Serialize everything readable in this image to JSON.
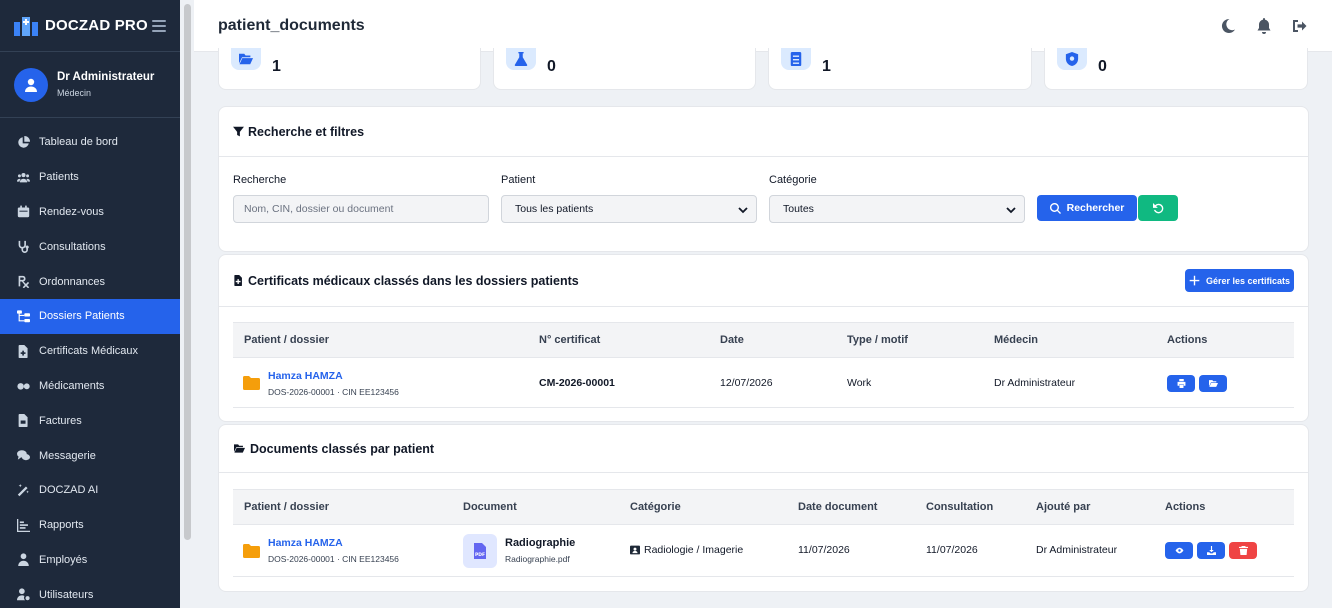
{
  "app": {
    "brand": "DOCZAD PRO",
    "page_title": "patient_documents"
  },
  "user": {
    "name": "Dr Administrateur",
    "role": "Médecin"
  },
  "nav": [
    {
      "label": "Tableau de bord",
      "icon": "chart-pie-icon",
      "active": false
    },
    {
      "label": "Patients",
      "icon": "users-icon",
      "active": false
    },
    {
      "label": "Rendez-vous",
      "icon": "calendar-icon",
      "active": false
    },
    {
      "label": "Consultations",
      "icon": "stethoscope-icon",
      "active": false
    },
    {
      "label": "Ordonnances",
      "icon": "prescription-icon",
      "active": false
    },
    {
      "label": "Dossiers Patients",
      "icon": "folder-tree-icon",
      "active": true
    },
    {
      "label": "Certificats Médicaux",
      "icon": "file-medical-icon",
      "active": false
    },
    {
      "label": "Médicaments",
      "icon": "pills-icon",
      "active": false
    },
    {
      "label": "Factures",
      "icon": "file-invoice-icon",
      "active": false
    },
    {
      "label": "Messagerie",
      "icon": "comments-icon",
      "active": false
    },
    {
      "label": "DOCZAD AI",
      "icon": "magic-wand-icon",
      "active": false
    },
    {
      "label": "Rapports",
      "icon": "chart-bar-icon",
      "active": false
    },
    {
      "label": "Employés",
      "icon": "user-tie-icon",
      "active": false
    },
    {
      "label": "Utilisateurs",
      "icon": "user-gear-icon",
      "active": false
    }
  ],
  "stats": [
    {
      "value": "1",
      "icon": "folder-open-icon"
    },
    {
      "value": "0",
      "icon": "flask-icon"
    },
    {
      "value": "1",
      "icon": "file-medical-icon"
    },
    {
      "value": "0",
      "icon": "shield-icon"
    }
  ],
  "filters": {
    "title": "Recherche et filtres",
    "search_label": "Recherche",
    "search_placeholder": "Nom, CIN, dossier ou document",
    "patient_label": "Patient",
    "patient_value": "Tous les patients",
    "category_label": "Catégorie",
    "category_value": "Toutes",
    "search_button": "Rechercher"
  },
  "certificates": {
    "title": "Certificats médicaux classés dans les dossiers patients",
    "manage_button": "Gérer les certificats",
    "columns": [
      "Patient / dossier",
      "N° certificat",
      "Date",
      "Type / motif",
      "Médecin",
      "Actions"
    ],
    "rows": [
      {
        "patient": "Hamza HAMZA",
        "folder": "DOS-2026-00001 · CIN EE123456",
        "number": "CM-2026-00001",
        "date": "12/07/2026",
        "type": "Work",
        "doctor": "Dr Administrateur"
      }
    ]
  },
  "documents": {
    "title": "Documents classés par patient",
    "columns": [
      "Patient / dossier",
      "Document",
      "Catégorie",
      "Date document",
      "Consultation",
      "Ajouté par",
      "Actions"
    ],
    "rows": [
      {
        "patient": "Hamza HAMZA",
        "folder": "DOS-2026-00001 · CIN EE123456",
        "doc_name": "Radiographie",
        "doc_file": "Radiographie.pdf",
        "category": "Radiologie / Imagerie",
        "doc_date": "11/07/2026",
        "consultation": "11/07/2026",
        "added_by": "Dr Administrateur"
      }
    ]
  },
  "colors": {
    "primary": "#2563eb",
    "success": "#10b981",
    "danger": "#ef4444",
    "sidebar": "#1e293b",
    "folder": "#f59e0b"
  }
}
